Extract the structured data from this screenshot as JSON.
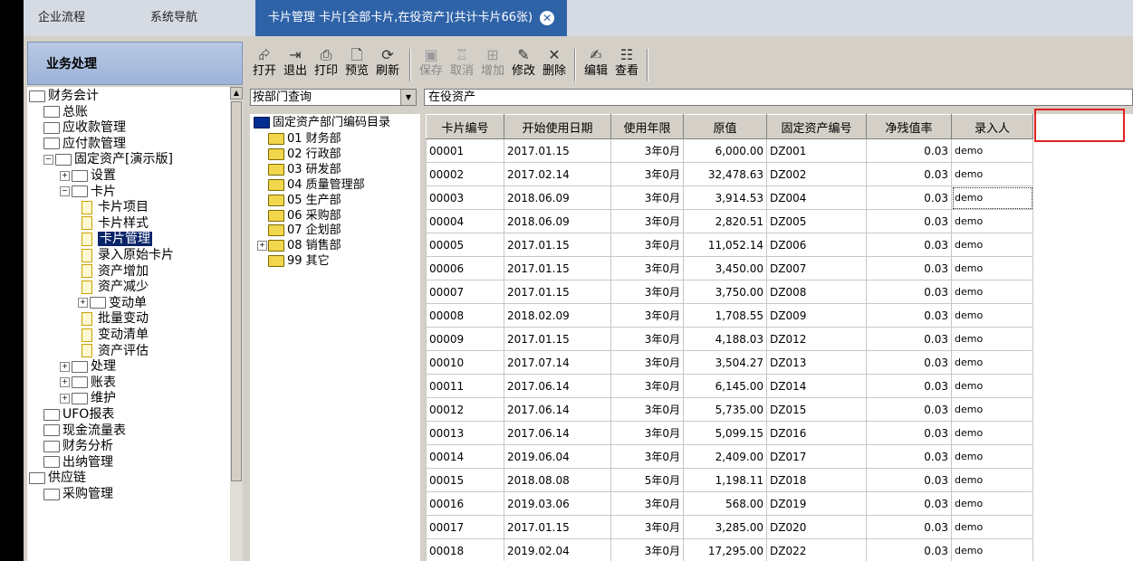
{
  "top_tabs": {
    "tab1": "企业流程",
    "tab2": "系统导航",
    "active": "卡片管理  卡片[全部卡片,在役资产](共计卡片66张)"
  },
  "left_panel": {
    "header": "业务处理",
    "tree": [
      {
        "label": "财务会计",
        "level": 0
      },
      {
        "label": "总账",
        "level": 1
      },
      {
        "label": "应收款管理",
        "level": 1
      },
      {
        "label": "应付款管理",
        "level": 1
      },
      {
        "label": "固定资产[演示版]",
        "level": 1
      },
      {
        "label": "设置",
        "level": 2
      },
      {
        "label": "卡片",
        "level": 2
      },
      {
        "label": "卡片项目",
        "level": 3
      },
      {
        "label": "卡片样式",
        "level": 3
      },
      {
        "label": "卡片管理",
        "level": 3
      },
      {
        "label": "录入原始卡片",
        "level": 3
      },
      {
        "label": "资产增加",
        "level": 3
      },
      {
        "label": "资产减少",
        "level": 3
      },
      {
        "label": "变动单",
        "level": 3
      },
      {
        "label": "批量变动",
        "level": 3
      },
      {
        "label": "变动清单",
        "level": 3
      },
      {
        "label": "资产评估",
        "level": 3
      },
      {
        "label": "处理",
        "level": 2
      },
      {
        "label": "账表",
        "level": 2
      },
      {
        "label": "维护",
        "level": 2
      },
      {
        "label": "UFO报表",
        "level": 1
      },
      {
        "label": "现金流量表",
        "level": 1
      },
      {
        "label": "财务分析",
        "level": 1
      },
      {
        "label": "出纳管理",
        "level": 1
      },
      {
        "label": "供应链",
        "level": 0
      },
      {
        "label": "采购管理",
        "level": 1
      }
    ]
  },
  "toolbar": {
    "open": "打开",
    "exit": "退出",
    "print": "打印",
    "preview": "预览",
    "refresh": "刷新",
    "save": "保存",
    "cancel": "取消",
    "add": "增加",
    "modify": "修改",
    "delete": "删除",
    "edit": "编辑",
    "view": "查看"
  },
  "filter": {
    "query_mode": "按部门查询",
    "status": "在役资产"
  },
  "dept_tree": {
    "root": "固定资产部门编码目录",
    "items": [
      "01 财务部",
      "02 行政部",
      "03 研发部",
      "04 质量管理部",
      "05 生产部",
      "06 采购部",
      "07 企划部",
      "08 销售部",
      "99 其它"
    ]
  },
  "grid": {
    "columns": [
      "卡片编号",
      "开始使用日期",
      "使用年限",
      "原值",
      "固定资产编号",
      "净残值率",
      "录入人"
    ],
    "rows": [
      [
        "00001",
        "2017.01.15",
        "3年0月",
        "6,000.00",
        "DZ001",
        "0.03",
        "demo"
      ],
      [
        "00002",
        "2017.02.14",
        "3年0月",
        "32,478.63",
        "DZ002",
        "0.03",
        "demo"
      ],
      [
        "00003",
        "2018.06.09",
        "3年0月",
        "3,914.53",
        "DZ004",
        "0.03",
        "demo"
      ],
      [
        "00004",
        "2018.06.09",
        "3年0月",
        "2,820.51",
        "DZ005",
        "0.03",
        "demo"
      ],
      [
        "00005",
        "2017.01.15",
        "3年0月",
        "11,052.14",
        "DZ006",
        "0.03",
        "demo"
      ],
      [
        "00006",
        "2017.01.15",
        "3年0月",
        "3,450.00",
        "DZ007",
        "0.03",
        "demo"
      ],
      [
        "00007",
        "2017.01.15",
        "3年0月",
        "3,750.00",
        "DZ008",
        "0.03",
        "demo"
      ],
      [
        "00008",
        "2018.02.09",
        "3年0月",
        "1,708.55",
        "DZ009",
        "0.03",
        "demo"
      ],
      [
        "00009",
        "2017.01.15",
        "3年0月",
        "4,188.03",
        "DZ012",
        "0.03",
        "demo"
      ],
      [
        "00010",
        "2017.07.14",
        "3年0月",
        "3,504.27",
        "DZ013",
        "0.03",
        "demo"
      ],
      [
        "00011",
        "2017.06.14",
        "3年0月",
        "6,145.00",
        "DZ014",
        "0.03",
        "demo"
      ],
      [
        "00012",
        "2017.06.14",
        "3年0月",
        "5,735.00",
        "DZ015",
        "0.03",
        "demo"
      ],
      [
        "00013",
        "2017.06.14",
        "3年0月",
        "5,099.15",
        "DZ016",
        "0.03",
        "demo"
      ],
      [
        "00014",
        "2019.06.04",
        "3年0月",
        "2,409.00",
        "DZ017",
        "0.03",
        "demo"
      ],
      [
        "00015",
        "2018.08.08",
        "5年0月",
        "1,198.11",
        "DZ018",
        "0.03",
        "demo"
      ],
      [
        "00016",
        "2019.03.06",
        "3年0月",
        "568.00",
        "DZ019",
        "0.03",
        "demo"
      ],
      [
        "00017",
        "2017.01.15",
        "3年0月",
        "3,285.00",
        "DZ020",
        "0.03",
        "demo"
      ],
      [
        "00018",
        "2019.02.04",
        "3年0月",
        "17,295.00",
        "DZ022",
        "0.03",
        "demo"
      ]
    ]
  }
}
